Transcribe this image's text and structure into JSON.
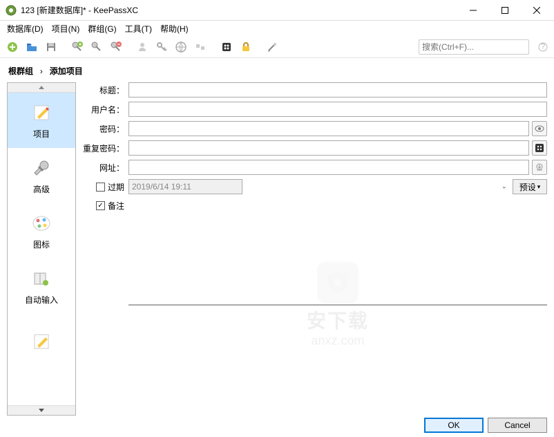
{
  "window": {
    "title": "123 [新建数据库]* - KeePassXC"
  },
  "menu": {
    "database": "数据库(D)",
    "entries": "项目(N)",
    "groups": "群组(G)",
    "tools": "工具(T)",
    "help": "帮助(H)"
  },
  "toolbar": {
    "search_placeholder": "搜索(Ctrl+F)..."
  },
  "breadcrumb": {
    "root": "根群组",
    "current": "添加项目"
  },
  "sidenav": {
    "entry": "项目",
    "advanced": "高级",
    "icon": "图标",
    "autotype": "自动输入"
  },
  "form": {
    "title_label": "标题：",
    "username_label": "用户名：",
    "password_label": "密码：",
    "repeat_label": "重复密码：",
    "url_label": "网址：",
    "expires_label": "过期",
    "notes_label": "备注",
    "expires_value": "2019/6/14 19:11",
    "preset_label": "预设",
    "title_value": "",
    "username_value": "",
    "password_value": "",
    "repeat_value": "",
    "url_value": ""
  },
  "buttons": {
    "ok": "OK",
    "cancel": "Cancel"
  },
  "watermark": {
    "text": "安下载",
    "sub": "anxz.com"
  }
}
